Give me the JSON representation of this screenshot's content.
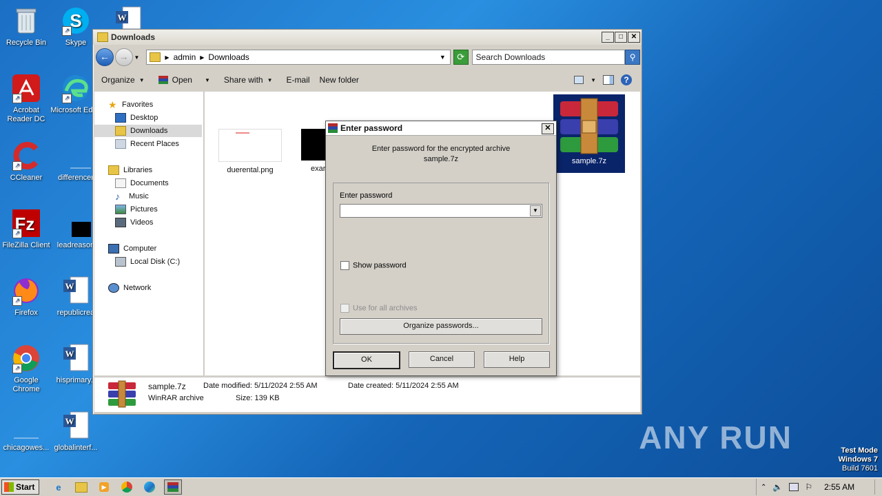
{
  "desktop_icons": [
    {
      "label": "Recycle Bin"
    },
    {
      "label": "Skype"
    },
    {
      "label": "Acrobat Reader DC"
    },
    {
      "label": "Microsoft Edge"
    },
    {
      "label": "CCleaner"
    },
    {
      "label": "differencer"
    },
    {
      "label": "FileZilla Client"
    },
    {
      "label": "leadreason"
    },
    {
      "label": "Firefox"
    },
    {
      "label": "republicrea"
    },
    {
      "label": "Google Chrome"
    },
    {
      "label": "hisprimary.r"
    },
    {
      "label": "chicagowes..."
    },
    {
      "label": "globalinterf..."
    }
  ],
  "explorer": {
    "title": "Downloads",
    "breadcrumb": [
      "admin",
      "Downloads"
    ],
    "search_placeholder": "Search Downloads",
    "toolbar": {
      "organize": "Organize",
      "open": "Open",
      "share_with": "Share with",
      "email": "E-mail",
      "new_folder": "New folder"
    },
    "nav": {
      "favorites": "Favorites",
      "desktop": "Desktop",
      "downloads": "Downloads",
      "recent_places": "Recent Places",
      "libraries": "Libraries",
      "documents": "Documents",
      "music": "Music",
      "pictures": "Pictures",
      "videos": "Videos",
      "computer": "Computer",
      "local_disk": "Local Disk (C:)",
      "network": "Network"
    },
    "files": [
      {
        "name": "duerental.png"
      },
      {
        "name": "exar"
      },
      {
        "name": "sample.7z"
      }
    ],
    "details": {
      "name": "sample.7z",
      "type": "WinRAR archive",
      "date_modified_label": "Date modified:",
      "date_modified": "5/11/2024 2:55 AM",
      "date_created_label": "Date created:",
      "date_created": "5/11/2024 2:55 AM",
      "size_label": "Size:",
      "size": "139 KB"
    }
  },
  "dialog": {
    "title": "Enter password",
    "message_line1": "Enter password for the encrypted archive",
    "message_line2": "sample.7z",
    "password_label": "Enter password",
    "password_value": "",
    "show_password": "Show password",
    "use_for_all": "Use for all archives",
    "organize_passwords": "Organize passwords...",
    "ok": "OK",
    "cancel": "Cancel",
    "help": "Help"
  },
  "taskbar": {
    "start": "Start",
    "clock": "2:55 AM"
  },
  "watermark": "ANY RUN",
  "test_mode": {
    "line1": "Test Mode",
    "line2": "Windows 7",
    "line3": "Build 7601"
  },
  "colors": {
    "selection": "#0a246a",
    "title_gradient_start": "#f0efe9"
  }
}
